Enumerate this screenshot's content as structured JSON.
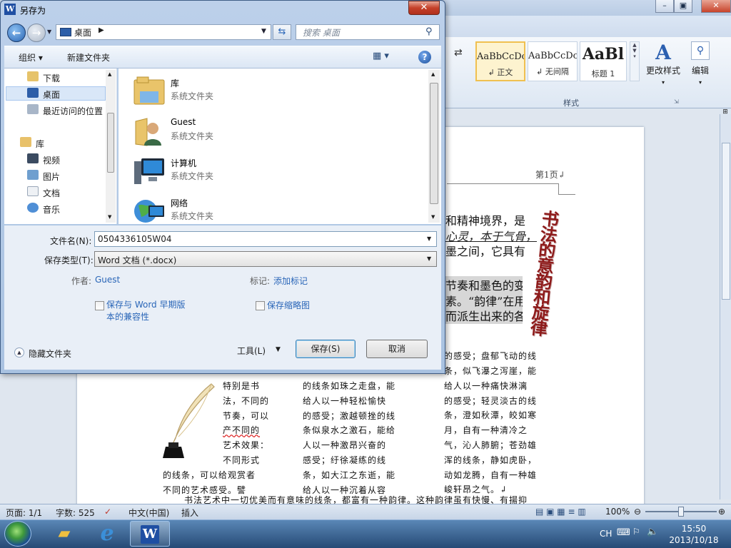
{
  "dialog": {
    "title": "另存为",
    "address": {
      "location": "桌面"
    },
    "search_placeholder": "搜索 桌面",
    "toolbar": {
      "organize": "组织 ▾",
      "new_folder": "新建文件夹"
    },
    "nav_items": [
      {
        "label": "下载",
        "icon": "download-folder-icon"
      },
      {
        "label": "桌面",
        "icon": "desktop-icon"
      },
      {
        "label": "最近访问的位置",
        "icon": "recent-places-icon"
      },
      {
        "label": "库",
        "icon": "library-icon"
      },
      {
        "label": "视频",
        "icon": "video-icon"
      },
      {
        "label": "图片",
        "icon": "pictures-icon"
      },
      {
        "label": "文档",
        "icon": "documents-icon"
      },
      {
        "label": "音乐",
        "icon": "music-icon"
      }
    ],
    "files": [
      {
        "name": "库",
        "type": "系统文件夹",
        "icon": "library-folder-icon"
      },
      {
        "name": "Guest",
        "type": "系统文件夹",
        "icon": "user-folder-icon"
      },
      {
        "name": "计算机",
        "type": "系统文件夹",
        "icon": "computer-icon"
      },
      {
        "name": "网络",
        "type": "系统文件夹",
        "icon": "network-icon"
      }
    ],
    "filename_label": "文件名(N):",
    "filename_value": "0504336105W04",
    "filetype_label": "保存类型(T):",
    "filetype_value": "Word 文档 (*.docx)",
    "author_label": "作者:",
    "author_value": "Guest",
    "tags_label": "标记:",
    "tags_value": "添加标记",
    "compat_line1": "保存与 Word 早期版",
    "compat_line2": "本的兼容性",
    "thumbnail": "保存缩略图",
    "hide_folders": "隐藏文件夹",
    "tools": "工具(L)",
    "save": "保存(S)",
    "cancel": "取消"
  },
  "ribbon": {
    "styles": [
      {
        "sample": "AaBbCcDc",
        "name": "↲ 正文"
      },
      {
        "sample": "AaBbCcDc",
        "name": "↲ 无间隔"
      },
      {
        "sample": "AaBl",
        "name": "标题 1"
      }
    ],
    "change_styles": "更改样式",
    "change_styles_glyph": "A",
    "edit": "编辑",
    "styles_group": "样式",
    "para_mark": "⇄"
  },
  "document": {
    "page_header": "第1页↲",
    "vertical_title": "书法的意韵和旋律",
    "p1": [
      "和精神境界，是",
      "心灵，本于气骨，",
      "墨之间，它具有"
    ],
    "p2": [
      "节奏和墨色的变",
      "素。“韵律”在用",
      "而派生出来的各"
    ],
    "col_top": "的感受；盘郁飞动的线",
    "col1": [
      "特别是书",
      "法，不同的",
      "节奏，可以",
      "产不同的",
      "艺术效果：",
      "不同形式"
    ],
    "col1_wide": [
      "的线条，可以给观赏者",
      "不同的艺术感受。譬"
    ],
    "col2": [
      "的线条如珠之走盘，能",
      "给人以一种轻松愉快",
      "的感受；激越顿挫的线",
      "条似泉水之激石，能给",
      "人以一种激昂兴奋的",
      "感受；纡徐凝练的线",
      "条，如大江之东逝，能",
      "给人以一种沉着从容"
    ],
    "col3": [
      "条，似飞瀑之泻崖，能",
      "给人以一种痛快淋漓",
      "的感受；轻灵淡古的线",
      "条，澄如秋潭，皎如寒",
      "月，自有一种清冷之",
      "气，沁人肺腑；苍劲雄",
      "浑的线条，静如虎卧，",
      "动如龙腾，自有一种雄",
      "峻轩昂之气。↲"
    ],
    "bottom_line": "书法艺术中一切优美而有意味的线条，都富有一种韵律。这种韵律虽有快慢、有揚抑"
  },
  "statusbar": {
    "page": "页面: 1/1",
    "words": "字数: 525",
    "lang": "中文(中国)",
    "mode": "插入",
    "zoom": "100%"
  },
  "word_title_buttons": [
    "–",
    "▣",
    "✕"
  ],
  "taskbar": {
    "ime": "CH",
    "time": "15:50",
    "date": "2013/10/18"
  },
  "colors": {
    "accent": "#2a66b8",
    "title_red": "#8e1b1b"
  }
}
